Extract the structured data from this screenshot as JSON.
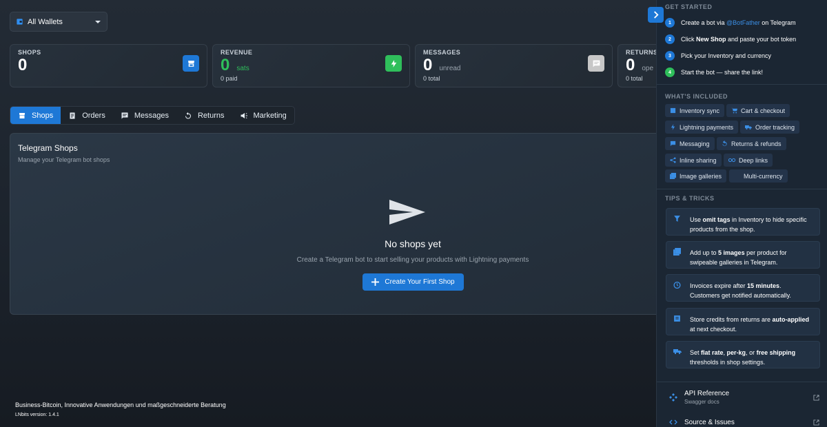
{
  "wallet_select": {
    "label": "All Wallets"
  },
  "stats": {
    "shops": {
      "label": "SHOPS",
      "value": "0"
    },
    "revenue": {
      "label": "REVENUE",
      "value": "0",
      "unit": "sats",
      "sub": "0 paid"
    },
    "messages": {
      "label": "MESSAGES",
      "value": "0",
      "unit": "unread",
      "sub": "0 total"
    },
    "returns": {
      "label": "RETURNS",
      "value": "0",
      "unit": "ope",
      "sub": "0 total"
    }
  },
  "tabs": [
    {
      "label": "Shops",
      "icon": "storefront-icon"
    },
    {
      "label": "Orders",
      "icon": "receipt-icon"
    },
    {
      "label": "Messages",
      "icon": "chat-icon"
    },
    {
      "label": "Returns",
      "icon": "undo-icon"
    },
    {
      "label": "Marketing",
      "icon": "campaign-icon"
    }
  ],
  "panel": {
    "title": "Telegram Shops",
    "subtitle": "Manage your Telegram bot shops",
    "empty_title": "No shops yet",
    "empty_desc": "Create a Telegram bot to start selling your products with Lightning payments",
    "create_button": "Create Your First Shop"
  },
  "footer": {
    "company": "Business-Bitcoin, Innovative Anwendungen und maßgeschneiderte Beratung",
    "version": "LNbits version: 1.4.1"
  },
  "sidebar": {
    "get_started": {
      "title": "GET STARTED",
      "steps": [
        {
          "num": "1",
          "pre": "Create a bot via ",
          "link": "@BotFather",
          "post": " on Telegram"
        },
        {
          "num": "2",
          "pre": "Click ",
          "bold": "New Shop",
          "post": " and paste your bot token"
        },
        {
          "num": "3",
          "pre": "Pick your Inventory and currency"
        },
        {
          "num": "4",
          "pre": "Start the bot — share the link!"
        }
      ]
    },
    "included": {
      "title": "WHAT'S INCLUDED",
      "chips": [
        {
          "label": "Inventory sync",
          "icon": "inventory-icon"
        },
        {
          "label": "Cart & checkout",
          "icon": "cart-icon"
        },
        {
          "label": "Lightning payments",
          "icon": "lightning-icon"
        },
        {
          "label": "Order tracking",
          "icon": "truck-icon"
        },
        {
          "label": "Messaging",
          "icon": "chat-icon"
        },
        {
          "label": "Returns & refunds",
          "icon": "undo-icon"
        },
        {
          "label": "Inline sharing",
          "icon": "share-icon"
        },
        {
          "label": "Deep links",
          "icon": "link-icon"
        },
        {
          "label": "Image galleries",
          "icon": "gallery-icon"
        },
        {
          "label": "Multi-currency",
          "icon": "currency-icon"
        }
      ]
    },
    "tips": {
      "title": "TIPS & TRICKS",
      "items": [
        {
          "icon": "filter-icon",
          "p1": "Use ",
          "b1": "omit tags",
          "p2": " in Inventory to hide specific products from the shop."
        },
        {
          "icon": "gallery-icon",
          "p1": "Add up to ",
          "b1": "5 images",
          "p2": " per product for swipeable galleries in Telegram."
        },
        {
          "icon": "timer-icon",
          "p1": "Invoices expire after ",
          "b1": "15 minutes",
          "p2": ". Customers get notified automatically."
        },
        {
          "icon": "credit-icon",
          "p1": "Store credits from returns are ",
          "b1": "auto-applied",
          "p2": " at next checkout."
        },
        {
          "icon": "truck-icon",
          "p1": "Set ",
          "b1": "flat rate",
          "p2": ", ",
          "b2": "per-kg",
          "p3": ", or ",
          "b3": "free shipping",
          "p4": " thresholds in shop settings."
        }
      ]
    },
    "links": [
      {
        "title": "API Reference",
        "subtitle": "Swagger docs",
        "icon": "api-icon"
      },
      {
        "title": "Source & Issues",
        "subtitle": "",
        "icon": "code-icon"
      }
    ]
  },
  "colors": {
    "primary": "#1e78d6",
    "success": "#2fbf5b",
    "message_badge": "#c7c7c7"
  }
}
